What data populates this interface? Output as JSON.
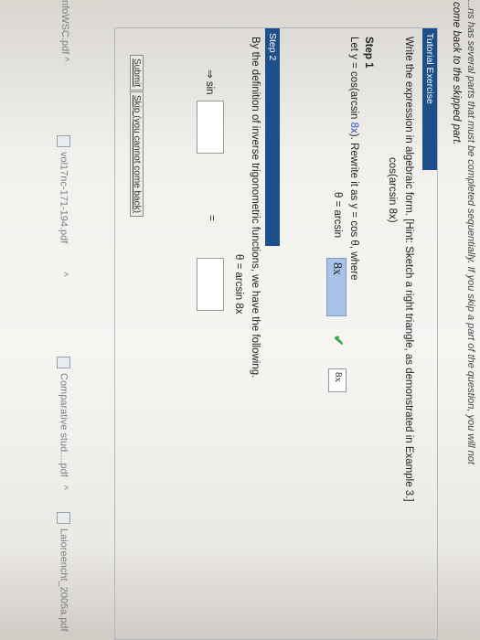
{
  "header": {
    "partial_line": "...ns has several parts that must be completed sequentially. If you skip a part of the question, you will not",
    "skip_notice": "come back to the skipped part."
  },
  "tutorial": {
    "label": "Tutorial Exercise",
    "instruction": "Write the expression in algebraic form. [Hint: Sketch a right triangle, as demonstrated in Example 3.]",
    "expression": "cos(arcsin 8x)"
  },
  "step1": {
    "label": "Step 1",
    "text_a": "Let y = cos(arcsin ",
    "text_b": "8x",
    "text_c": "). Rewrite it as y = cos θ, where",
    "theta_prefix": "θ = arcsin",
    "answer_value": "8x",
    "answer_hint": "8x"
  },
  "step2": {
    "label": "Step 2",
    "text": "By the definition of inverse trigonometric functions, we have the following.",
    "theta_line": "θ = arcsin 8x",
    "implies_sin": "⇒ sin",
    "equals": "=",
    "left_value": "",
    "right_value": ""
  },
  "buttons": {
    "submit": "Submit",
    "skip": "Skip (you cannot come back)"
  },
  "downloads": [
    {
      "name": "nfoWSC.pdf"
    },
    {
      "name": "vol17nc-171-194.pdf"
    },
    {
      "name": "Comparative stud....pdf"
    },
    {
      "name": "Laioreencht_2005a.pdf"
    }
  ],
  "colors": {
    "header_bar": "#1d4f8b",
    "answer_fill": "#a9c2e8",
    "variable_blue": "#2f4fc9",
    "check_green": "#3aa74f"
  }
}
